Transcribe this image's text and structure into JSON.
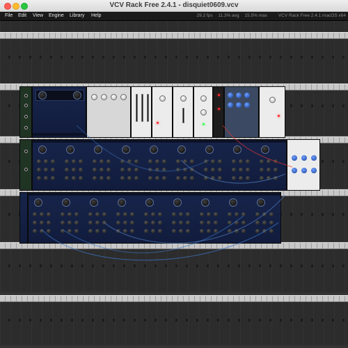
{
  "window": {
    "title": "VCV Rack Free 2.4.1 - disquiet0609.vcv"
  },
  "menu": {
    "items": [
      "File",
      "Edit",
      "View",
      "Engine",
      "Library",
      "Help"
    ]
  },
  "status": {
    "fps": "29.2 fps",
    "avg": "11.3% avg",
    "max": "15.5% max",
    "version": "VCV Rack Free 2.4.1 macOS x64"
  },
  "colors": {
    "module_blue": "#17244a",
    "cable_blue": "#3c78c8",
    "rail_silver": "#c4c4c4",
    "rack_background": "#343434",
    "menubar": "#1a1a1a"
  },
  "rack": {
    "module_groups": [
      "blue-sequencer-modules",
      "silver-utility-modules",
      "white-mixer-modules",
      "blue-voice-rows",
      "white-clock-module"
    ]
  }
}
